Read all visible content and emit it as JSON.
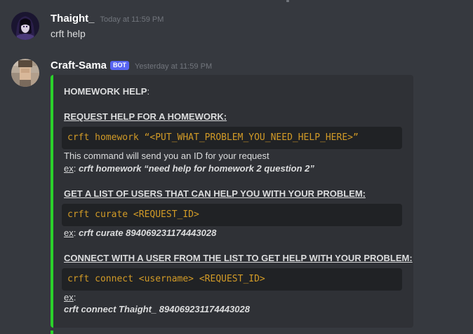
{
  "messages": [
    {
      "username": "Thaight_",
      "timestamp": "Today at 11:59 PM",
      "content": "crft help"
    },
    {
      "username": "Craft-Sama",
      "badge": "BOT",
      "timestamp": "Yesterday at 11:59 PM"
    }
  ],
  "embed": {
    "accent_color": "#2bd12b",
    "title": "HOMEWORK HELP",
    "title_suffix": ":",
    "sections": [
      {
        "heading": "REQUEST HELP FOR A HOMEWORK:",
        "code": "crft homework “<PUT_WHAT_PROBLEM_YOU_NEED_HELP_HERE>”",
        "description": "This command will send you an ID for your request",
        "example_label": "ex",
        "example_sep": ": ",
        "example": "crft homework “need help for homework 2 question 2”"
      },
      {
        "heading": "GET A LIST OF USERS THAT CAN HELP YOU WITH YOUR PROBLEM:",
        "code": "crft curate <REQUEST_ID>",
        "example_label": "ex",
        "example_sep": ": ",
        "example": "crft curate 894069231174443028"
      },
      {
        "heading": "CONNECT WITH A USER FROM THE LIST TO GET HELP WITH YOUR PROBLEM:",
        "code": "crft connect <username> <REQUEST_ID>",
        "example_label": "ex",
        "example_sep": ":",
        "example": "crft connect Thaight_ 894069231174443028"
      }
    ]
  },
  "colors": {
    "background": "#36393f",
    "embed_background": "#2f3136",
    "code_background": "#202225",
    "code_text": "#d29b27",
    "bot_badge": "#5865f2"
  }
}
